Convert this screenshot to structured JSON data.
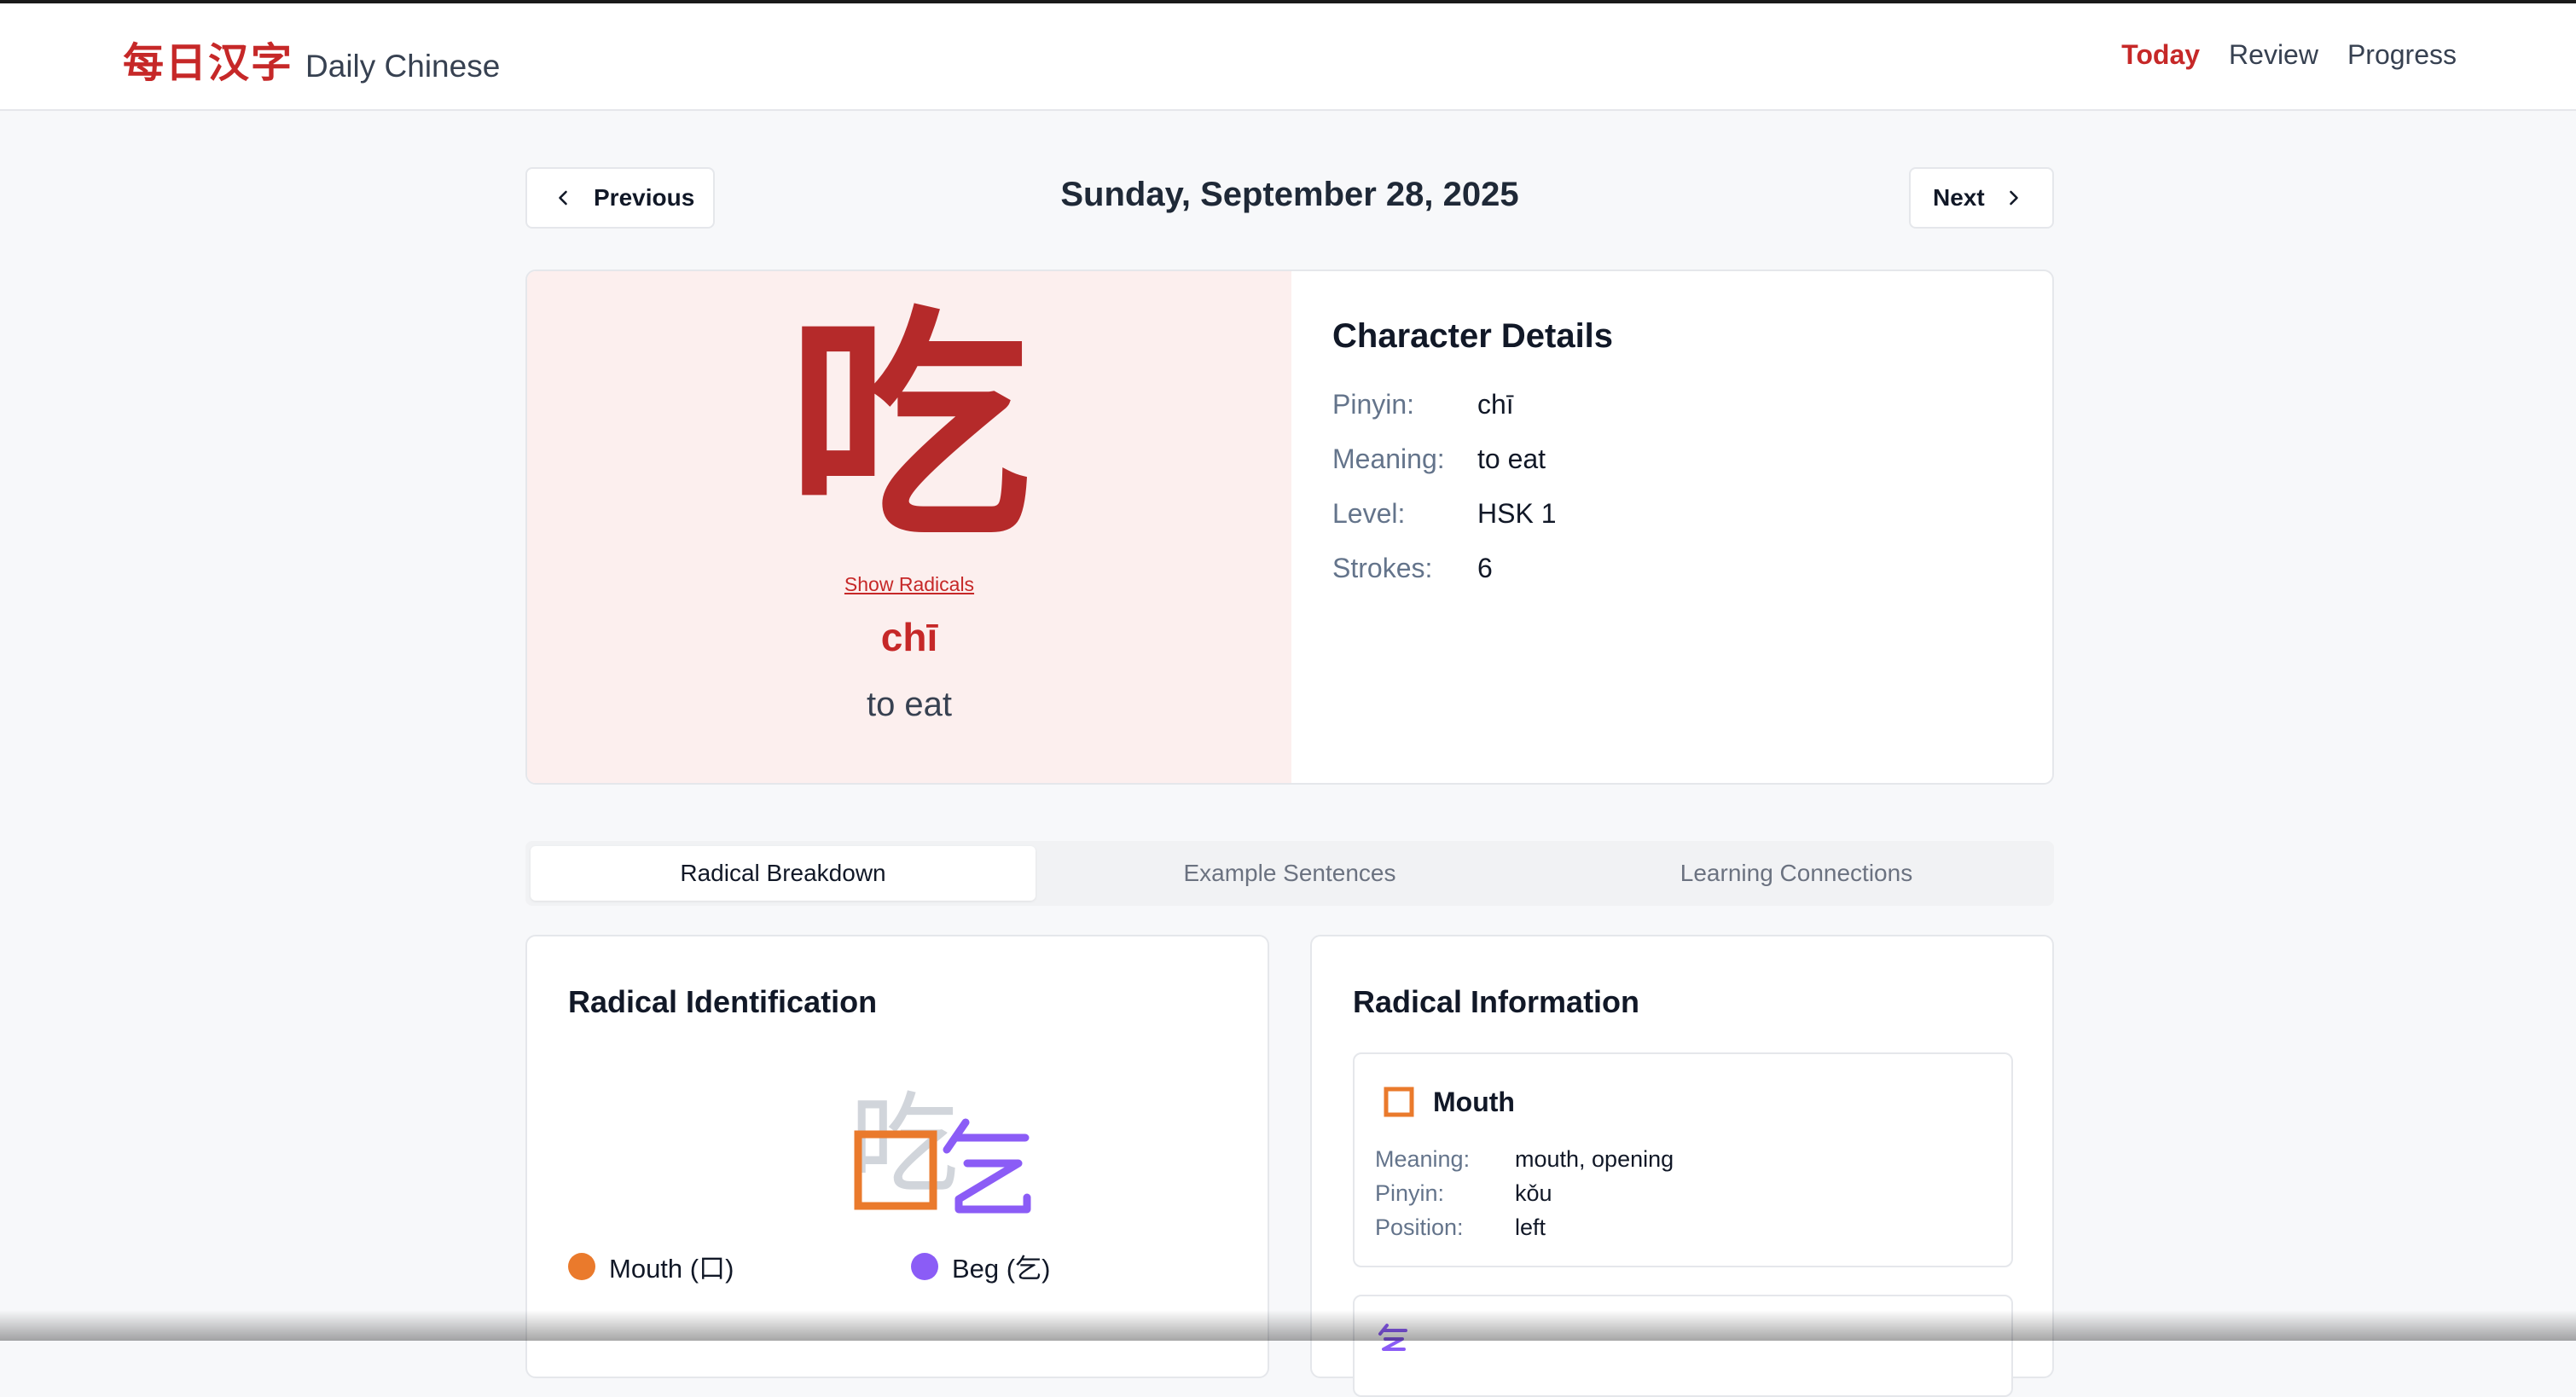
{
  "brand": {
    "chinese": "每日汉字",
    "name": "Daily Chinese"
  },
  "nav": {
    "items": [
      "Today",
      "Review",
      "Progress"
    ],
    "active": "Today"
  },
  "date_nav": {
    "previous_label": "Previous",
    "date": "Sunday, September 28, 2025",
    "next_label": "Next"
  },
  "character": {
    "glyph": "吃",
    "show_radicals_label": "Show Radicals",
    "pinyin": "chī",
    "meaning": "to eat"
  },
  "details": {
    "title": "Character Details",
    "rows": [
      {
        "label": "Pinyin:",
        "value": "chī"
      },
      {
        "label": "Meaning:",
        "value": "to eat"
      },
      {
        "label": "Level:",
        "value": "HSK 1"
      },
      {
        "label": "Strokes:",
        "value": "6"
      }
    ]
  },
  "tabs": {
    "items": [
      "Radical Breakdown",
      "Example Sentences",
      "Learning Connections"
    ],
    "active": "Radical Breakdown"
  },
  "radical_identification": {
    "title": "Radical Identification",
    "glyph": "吃",
    "legend": [
      {
        "label": "Mouth (口)",
        "color": "#ea7a2c"
      },
      {
        "label": "Beg (乞)",
        "color": "#8b5cf6"
      }
    ]
  },
  "radical_information": {
    "title": "Radical Information",
    "items": [
      {
        "name": "Mouth",
        "icon": "mouth-radical-icon",
        "color": "#ea7a2c",
        "rows": [
          {
            "label": "Meaning:",
            "value": "mouth, opening"
          },
          {
            "label": "Pinyin:",
            "value": "kǒu"
          },
          {
            "label": "Position:",
            "value": "left"
          }
        ]
      },
      {
        "icon": "beg-radical-icon",
        "color": "#8b5cf6"
      }
    ]
  },
  "colors": {
    "accent": "#c62828",
    "hero_bg": "#fcefee",
    "mouth": "#ea7a2c",
    "beg": "#8b5cf6"
  }
}
